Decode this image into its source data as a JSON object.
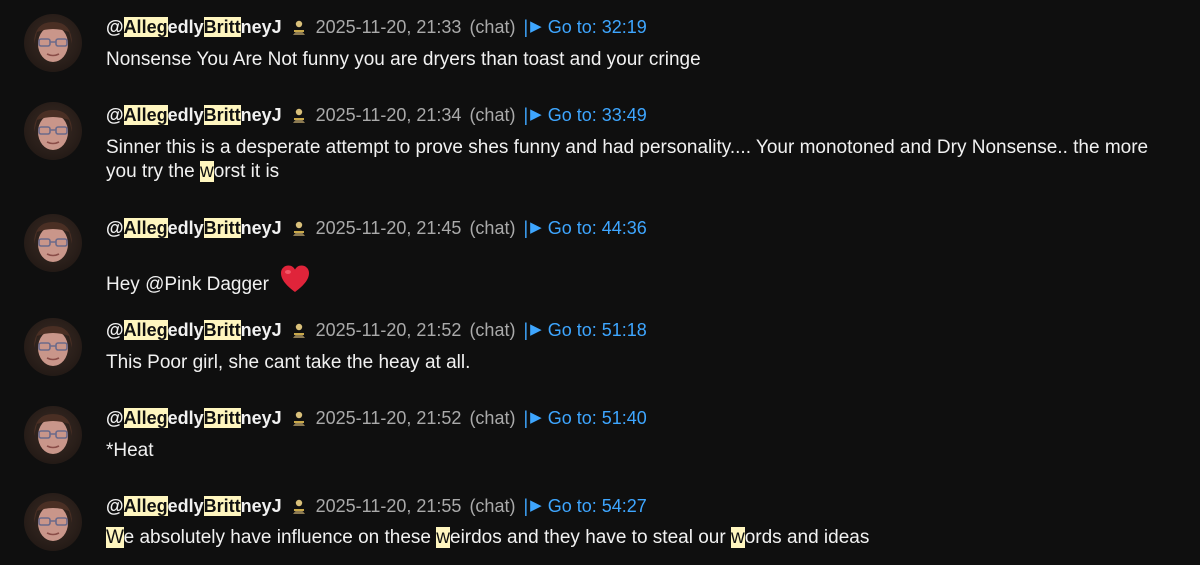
{
  "comments": [
    {
      "author_parts": [
        "@",
        "Alleg",
        "edly",
        "Britt",
        "neyJ"
      ],
      "timestamp": "2025-11-20, 21:33",
      "source": "(chat)",
      "goto_bar": "|",
      "goto_label": "Go to: 32:19",
      "text": "Nonsense You Are Not funny you are dryers than toast and your cringe"
    },
    {
      "author_parts": [
        "@",
        "Alleg",
        "edly",
        "Britt",
        "neyJ"
      ],
      "timestamp": "2025-11-20, 21:34",
      "source": "(chat)",
      "goto_bar": "|",
      "goto_label": "Go to: 33:49",
      "text_parts": [
        "Sinner this is a desperate attempt to prove shes funny and had personality.... Your monotoned and Dry Nonsense.. the more you try the ",
        "w",
        "orst it is"
      ]
    },
    {
      "author_parts": [
        "@",
        "Alleg",
        "edly",
        "Britt",
        "neyJ"
      ],
      "timestamp": "2025-11-20, 21:45",
      "source": "(chat)",
      "goto_bar": "|",
      "goto_label": "Go to: 44:36",
      "text": "Hey @Pink Dagger"
    },
    {
      "author_parts": [
        "@",
        "Alleg",
        "edly",
        "Britt",
        "neyJ"
      ],
      "timestamp": "2025-11-20, 21:52",
      "source": "(chat)",
      "goto_bar": "|",
      "goto_label": "Go to: 51:18",
      "text": "This Poor girl, she cant take the heay at all."
    },
    {
      "author_parts": [
        "@",
        "Alleg",
        "edly",
        "Britt",
        "neyJ"
      ],
      "timestamp": "2025-11-20, 21:52",
      "source": "(chat)",
      "goto_bar": "|",
      "goto_label": "Go to: 51:40",
      "text": "*Heat"
    },
    {
      "author_parts": [
        "@",
        "Alleg",
        "edly",
        "Britt",
        "neyJ"
      ],
      "timestamp": "2025-11-20, 21:55",
      "source": "(chat)",
      "goto_bar": "|",
      "goto_label": "Go to: 54:27",
      "text_parts": [
        "W",
        "e absolutely have influence on these ",
        "w",
        "eirdos and they have to steal our ",
        "w",
        "ords and ideas"
      ]
    }
  ],
  "icons": {
    "goto": "play-icon",
    "badge": "member-badge-icon",
    "emoji": "red-heart-icon"
  },
  "colors": {
    "background": "#0f0f0f",
    "text": "#f1f1f1",
    "meta": "#aaaaaa",
    "link": "#3ea6ff",
    "highlight": "#fff6bf",
    "heart": "#e0243a"
  }
}
